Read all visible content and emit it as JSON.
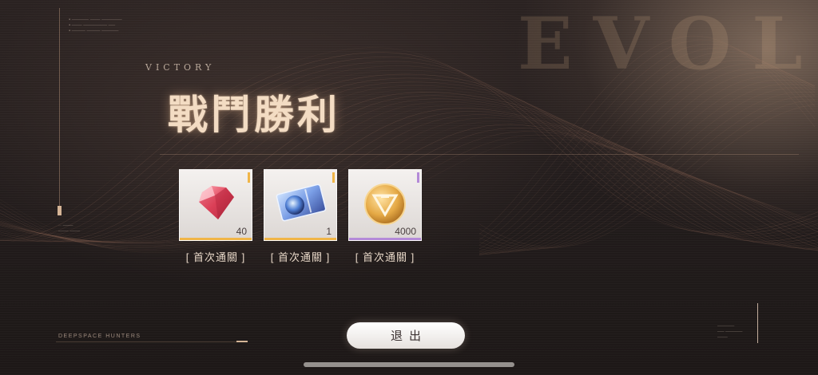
{
  "background_word": "EVOL",
  "header": {
    "victory_en": "VICTORY",
    "victory_title": "戰鬥勝利"
  },
  "rewards": [
    {
      "item": "red-diamond-icon",
      "count": "40",
      "label": "[ 首次通關 ]",
      "rarity_color": "#f0b548"
    },
    {
      "item": "blue-ticket-icon",
      "count": "1",
      "label": "[ 首次通關 ]",
      "rarity_color": "#f0b548"
    },
    {
      "item": "gold-coin-icon",
      "count": "4000",
      "label": "[ 首次通關 ]",
      "rarity_color": "#b48ad8"
    }
  ],
  "exit_button": {
    "label": "退出"
  },
  "footer": {
    "brand": "DEEPSPACE HUNTERS"
  },
  "colors": {
    "accent": "#f3dcc3",
    "wave": "#c08870",
    "gold": "#f0b548",
    "purple": "#b48ad8"
  }
}
